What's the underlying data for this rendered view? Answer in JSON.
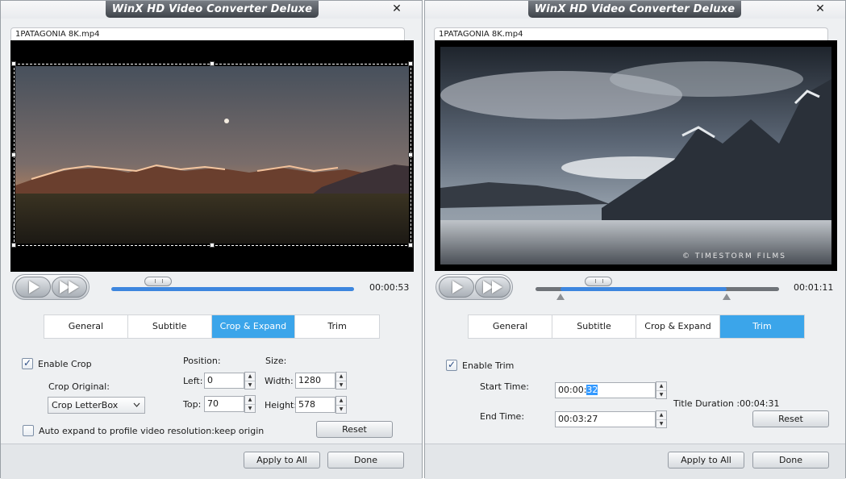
{
  "left_window": {
    "title": "WinX HD Video Converter Deluxe",
    "close_glyph": "✕",
    "file_tab": "1PATAGONIA 8K.mp4",
    "player": {
      "progress": 0.19,
      "time": "00:00:53"
    },
    "tabs": [
      {
        "label": "General",
        "active": false
      },
      {
        "label": "Subtitle",
        "active": false
      },
      {
        "label": "Crop & Expand",
        "active": true
      },
      {
        "label": "Trim",
        "active": false
      }
    ],
    "crop": {
      "enable_label": "Enable Crop",
      "enabled": true,
      "crop_original_label": "Crop Original:",
      "crop_original_value": "Crop LetterBox",
      "position_label": "Position:",
      "left_label": "Left:",
      "left_value": "0",
      "top_label": "Top:",
      "top_value": "70",
      "size_label": "Size:",
      "width_label": "Width:",
      "width_value": "1280",
      "height_label": "Height:",
      "height_value": "578",
      "auto_expand_label": "Auto expand to profile video resolution:keep origin",
      "auto_expand_checked": false,
      "reset_label": "Reset"
    },
    "footer": {
      "apply_all": "Apply to All",
      "done": "Done"
    }
  },
  "right_window": {
    "title": "WinX HD Video Converter Deluxe",
    "close_glyph": "✕",
    "file_tab": "1PATAGONIA 8K.mp4",
    "watermark": "© TIMESTORM FILMS",
    "player": {
      "progress": 0.24,
      "time": "00:01:11"
    },
    "tabs": [
      {
        "label": "General",
        "active": false
      },
      {
        "label": "Subtitle",
        "active": false
      },
      {
        "label": "Crop & Expand",
        "active": false
      },
      {
        "label": "Trim",
        "active": true
      }
    ],
    "trim": {
      "enable_label": "Enable Trim",
      "enabled": true,
      "start_label": "Start Time:",
      "start_prefix": "00:00:",
      "start_selected": "32",
      "end_label": "End Time:",
      "end_value": "00:03:27",
      "duration_label": "Title Duration :00:04:31",
      "reset_label": "Reset"
    },
    "footer": {
      "apply_all": "Apply to All",
      "done": "Done"
    }
  },
  "icons": [
    "close-icon",
    "play-icon",
    "fast-forward-icon",
    "checkbox-icon",
    "dropdown-arrow-icon",
    "spin-up-icon",
    "spin-down-icon"
  ],
  "colors": {
    "active_tab": "#3ba5ea",
    "progress_fill": "#3d86de",
    "text_selection": "#3399ff"
  }
}
